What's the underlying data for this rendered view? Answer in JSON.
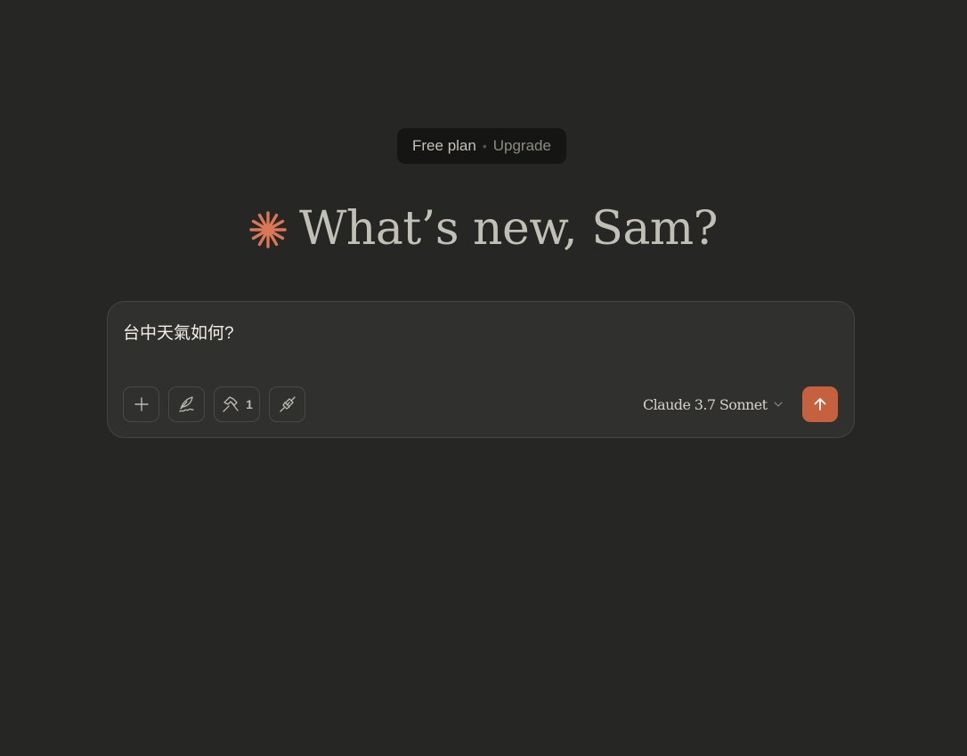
{
  "plan_badge": {
    "plan": "Free plan",
    "separator": "•",
    "upgrade": "Upgrade"
  },
  "greeting": {
    "text": "What’s new, Sam?",
    "icon": "spark-icon",
    "icon_color": "#d97757"
  },
  "composer": {
    "input_value": "台中天氣如何?",
    "tools": {
      "add_icon": "plus-icon",
      "style_icon": "feather-pen-icon",
      "tools_icon": "hammer-icon",
      "tools_count": "1",
      "integrations_icon": "plug-icon"
    },
    "model": {
      "label": "Claude 3.7 Sonnet",
      "icon": "chevron-down-icon"
    },
    "send": {
      "icon": "arrow-up-icon",
      "color": "#c6613f"
    }
  }
}
